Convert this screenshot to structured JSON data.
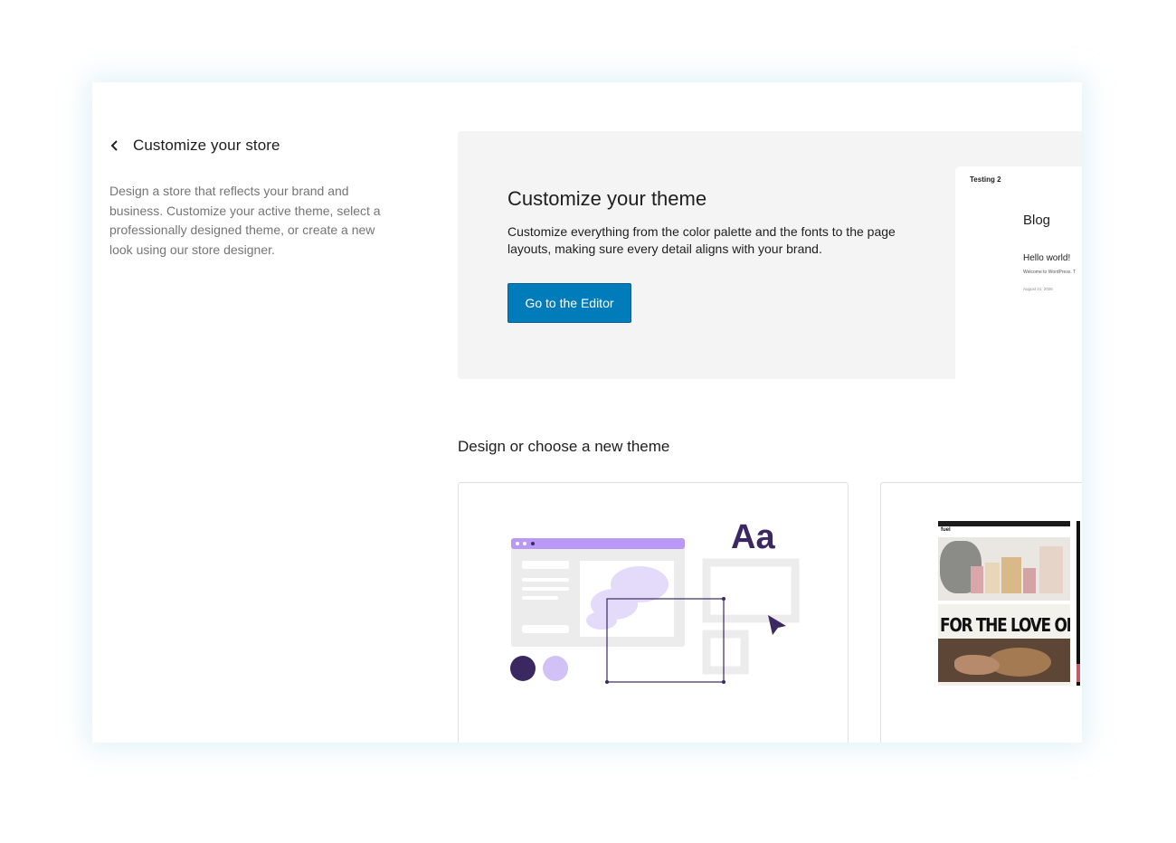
{
  "header": {
    "back_label": "Customize your store",
    "description": "Design a store that reflects your brand and business. Customize your active theme, select a professionally designed theme, or create a new look using our store designer."
  },
  "hero": {
    "title": "Customize your theme",
    "description": "Customize everything from the color palette and the fonts to the page layouts, making sure every detail aligns with your brand.",
    "button_label": "Go to the Editor",
    "preview": {
      "site_title": "Testing 2",
      "page_heading": "Blog",
      "post_title": "Hello world!",
      "post_excerpt": "Welcome to WordPress. T",
      "post_date": "August 21, 2025"
    }
  },
  "section": {
    "title": "Design or choose a new theme",
    "cards": [
      {
        "illustration_text": "Aa"
      },
      {
        "logo_text": "fuel",
        "headline": "FOR THE LOVE OF B"
      }
    ]
  },
  "colors": {
    "accent": "#007cba",
    "dark_purple": "#3c2861",
    "light_purple": "#d1c1f7",
    "lavender": "#b999f5"
  },
  "icons": {
    "back": "chevron-left-icon",
    "cursor": "cursor-arrow-icon"
  }
}
